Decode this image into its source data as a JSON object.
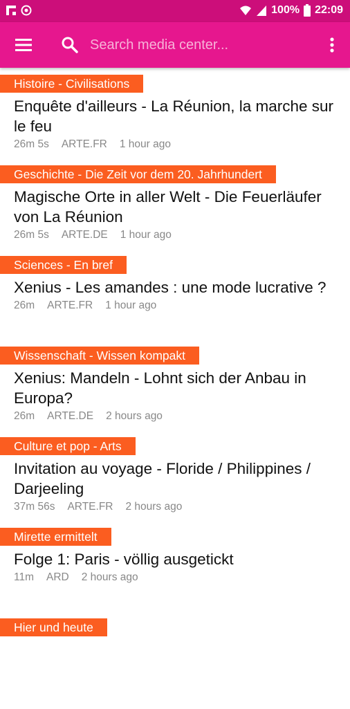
{
  "status_bar": {
    "battery": "100%",
    "time": "22:09",
    "icons": [
      "flipboard-icon",
      "sync-icon",
      "wifi-icon",
      "signal-icon",
      "battery-icon"
    ]
  },
  "app_bar": {
    "search_placeholder": "Search media center...",
    "icons": [
      "menu-icon",
      "search-icon",
      "overflow-menu-icon"
    ],
    "colors": {
      "app_bar": "#e6178e",
      "status_bar": "#cc0e7a",
      "category_badge": "#fb5d20"
    }
  },
  "videos": [
    {
      "category": "Histoire - Civilisations",
      "title": "Enquête d'ailleurs - La Réunion, la marche sur le feu",
      "duration": "26m 5s",
      "source": "ARTE.FR",
      "age": "1 hour ago"
    },
    {
      "category": "Geschichte - Die Zeit vor dem 20. Jahrhundert",
      "title": "Magische Orte in aller Welt - Die Feuerläufer von La Réunion",
      "duration": "26m 5s",
      "source": "ARTE.DE",
      "age": "1 hour ago"
    },
    {
      "category": "Sciences - En bref",
      "title": "Xenius - Les amandes : une mode lucrative ?",
      "duration": "26m",
      "source": "ARTE.FR",
      "age": "1 hour ago"
    },
    {
      "category": "Wissenschaft - Wissen kompakt",
      "title": "Xenius: Mandeln - Lohnt sich der Anbau in Europa?",
      "duration": "26m",
      "source": "ARTE.DE",
      "age": "2 hours ago"
    },
    {
      "category": "Culture et pop - Arts",
      "title": "Invitation au voyage - Floride / Philippines / Darjeeling",
      "duration": "37m 56s",
      "source": "ARTE.FR",
      "age": "2 hours ago"
    },
    {
      "category": "Mirette ermittelt",
      "title": "Folge 1: Paris - völlig ausgetickt",
      "duration": "11m",
      "source": "ARD",
      "age": "2 hours ago"
    },
    {
      "category": "Hier und heute",
      "title": "",
      "duration": "",
      "source": "",
      "age": ""
    }
  ]
}
